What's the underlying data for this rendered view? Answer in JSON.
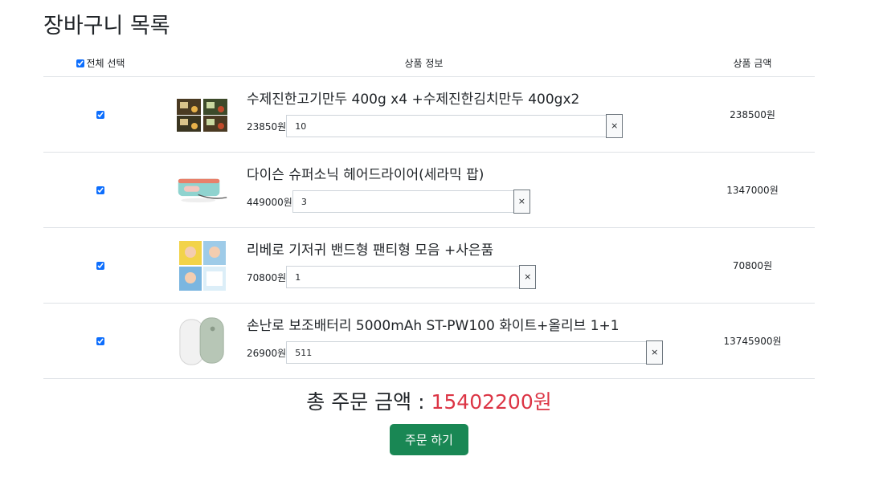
{
  "page": {
    "title": "장바구니 목록"
  },
  "table": {
    "headers": {
      "select_all": "전체 선택",
      "product_info": "상품 정보",
      "product_amount": "상품 금액"
    }
  },
  "items": [
    {
      "name": "수제진한고기만두 400g x4 +수제진한김치만두 400gx2",
      "price": "23850원",
      "quantity": "10",
      "total": "238500원",
      "checked": true
    },
    {
      "name": "다이슨 슈퍼소닉 헤어드라이어(세라믹 팝)",
      "price": "449000원",
      "quantity": "3",
      "total": "1347000원",
      "checked": true
    },
    {
      "name": "리베로 기저귀 밴드형 팬티형 모음 +사은품",
      "price": "70800원",
      "quantity": "1",
      "total": "70800원",
      "checked": true
    },
    {
      "name": "손난로 보조배터리 5000mAh ST-PW100 화이트+올리브 1+1",
      "price": "26900원",
      "quantity": "511",
      "total": "13745900원",
      "checked": true
    }
  ],
  "remove_label": "×",
  "summary": {
    "label": "총 주문 금액 : ",
    "amount": "15402200원"
  },
  "order_button": "주문 하기",
  "colors": {
    "accent": "#0d6efd",
    "amount": "#dc3545",
    "order_button": "#198754"
  }
}
